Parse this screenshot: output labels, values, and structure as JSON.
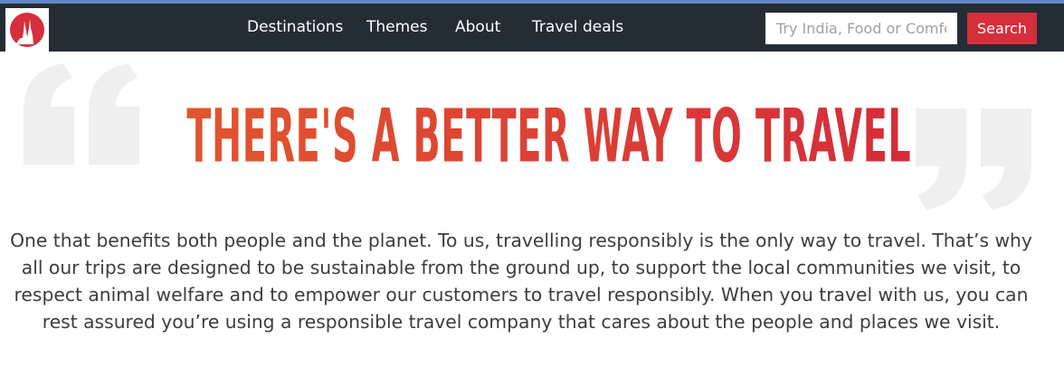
{
  "navbar": {
    "links": [
      {
        "label": "Destinations"
      },
      {
        "label": "Themes"
      },
      {
        "label": "About"
      },
      {
        "label": "Travel deals"
      }
    ],
    "search": {
      "placeholder": "Try India, Food or Comfort",
      "button_label": "Search"
    },
    "logo_icon": "brand-logo-icon"
  },
  "hero": {
    "headline": "THERE'S A BETTER WAY TO TRAVEL",
    "description": "One that benefits both people and the planet. To us, travelling responsibly is the only way to travel. That’s why all our trips are designed to be sustainable from the ground up, to support the local communities we visit, to respect animal welfare and to empower our customers to travel responsibly. When you travel with us, you can rest assured you’re using a responsible travel company that cares about the people and places we visit.",
    "quote_icons": [
      "open-quote-icon",
      "close-quote-icon"
    ]
  },
  "colors": {
    "navbar_bg": "#252d34",
    "accent_red": "#d42f3a",
    "headline_orange": "#e0552e",
    "quote_grey": "#efefef"
  }
}
